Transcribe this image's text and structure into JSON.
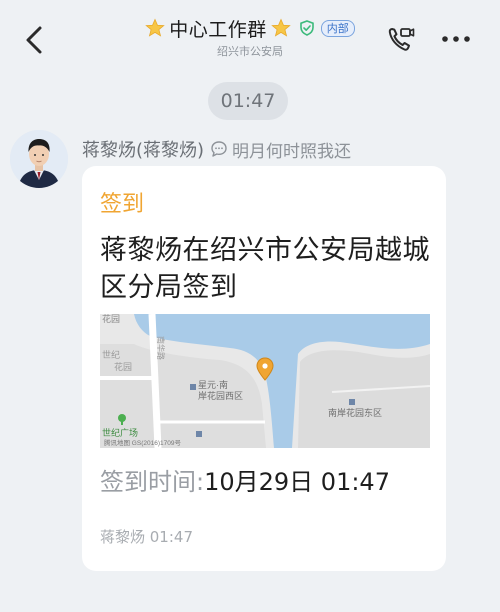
{
  "header": {
    "title": "中心工作群",
    "subtitle": "绍兴市公安局",
    "badge": "内部"
  },
  "timestamp": "01:47",
  "message": {
    "sender_name": "蒋黎炀(蒋黎炀)",
    "sender_signature": "明月何时照我还",
    "card": {
      "type_label": "签到",
      "text": "蒋黎炀在绍兴市公安局越城区分局签到",
      "map": {
        "labels": {
          "top_left": "花园",
          "road": "南华路",
          "left_mid_1": "世纪",
          "left_mid_2": "花园",
          "west": "星元·南\n岸花园西区",
          "east": "南岸花园东区",
          "plaza": "世纪广场",
          "copyright": "腾讯地图 GS(2016)1709号"
        }
      },
      "checkin_label": "签到时间:",
      "checkin_value": "10月29日 01:47",
      "footer": "蒋黎炀 01:47"
    }
  },
  "colors": {
    "accent_orange": "#f0a532",
    "background": "#eef1f4",
    "card": "#ffffff",
    "water": "#a9cbe8"
  },
  "icons": [
    "back-arrow-icon",
    "star-icon",
    "verified-shield-icon",
    "video-call-icon",
    "more-icon",
    "signature-bubble-icon",
    "map-pin-icon"
  ]
}
